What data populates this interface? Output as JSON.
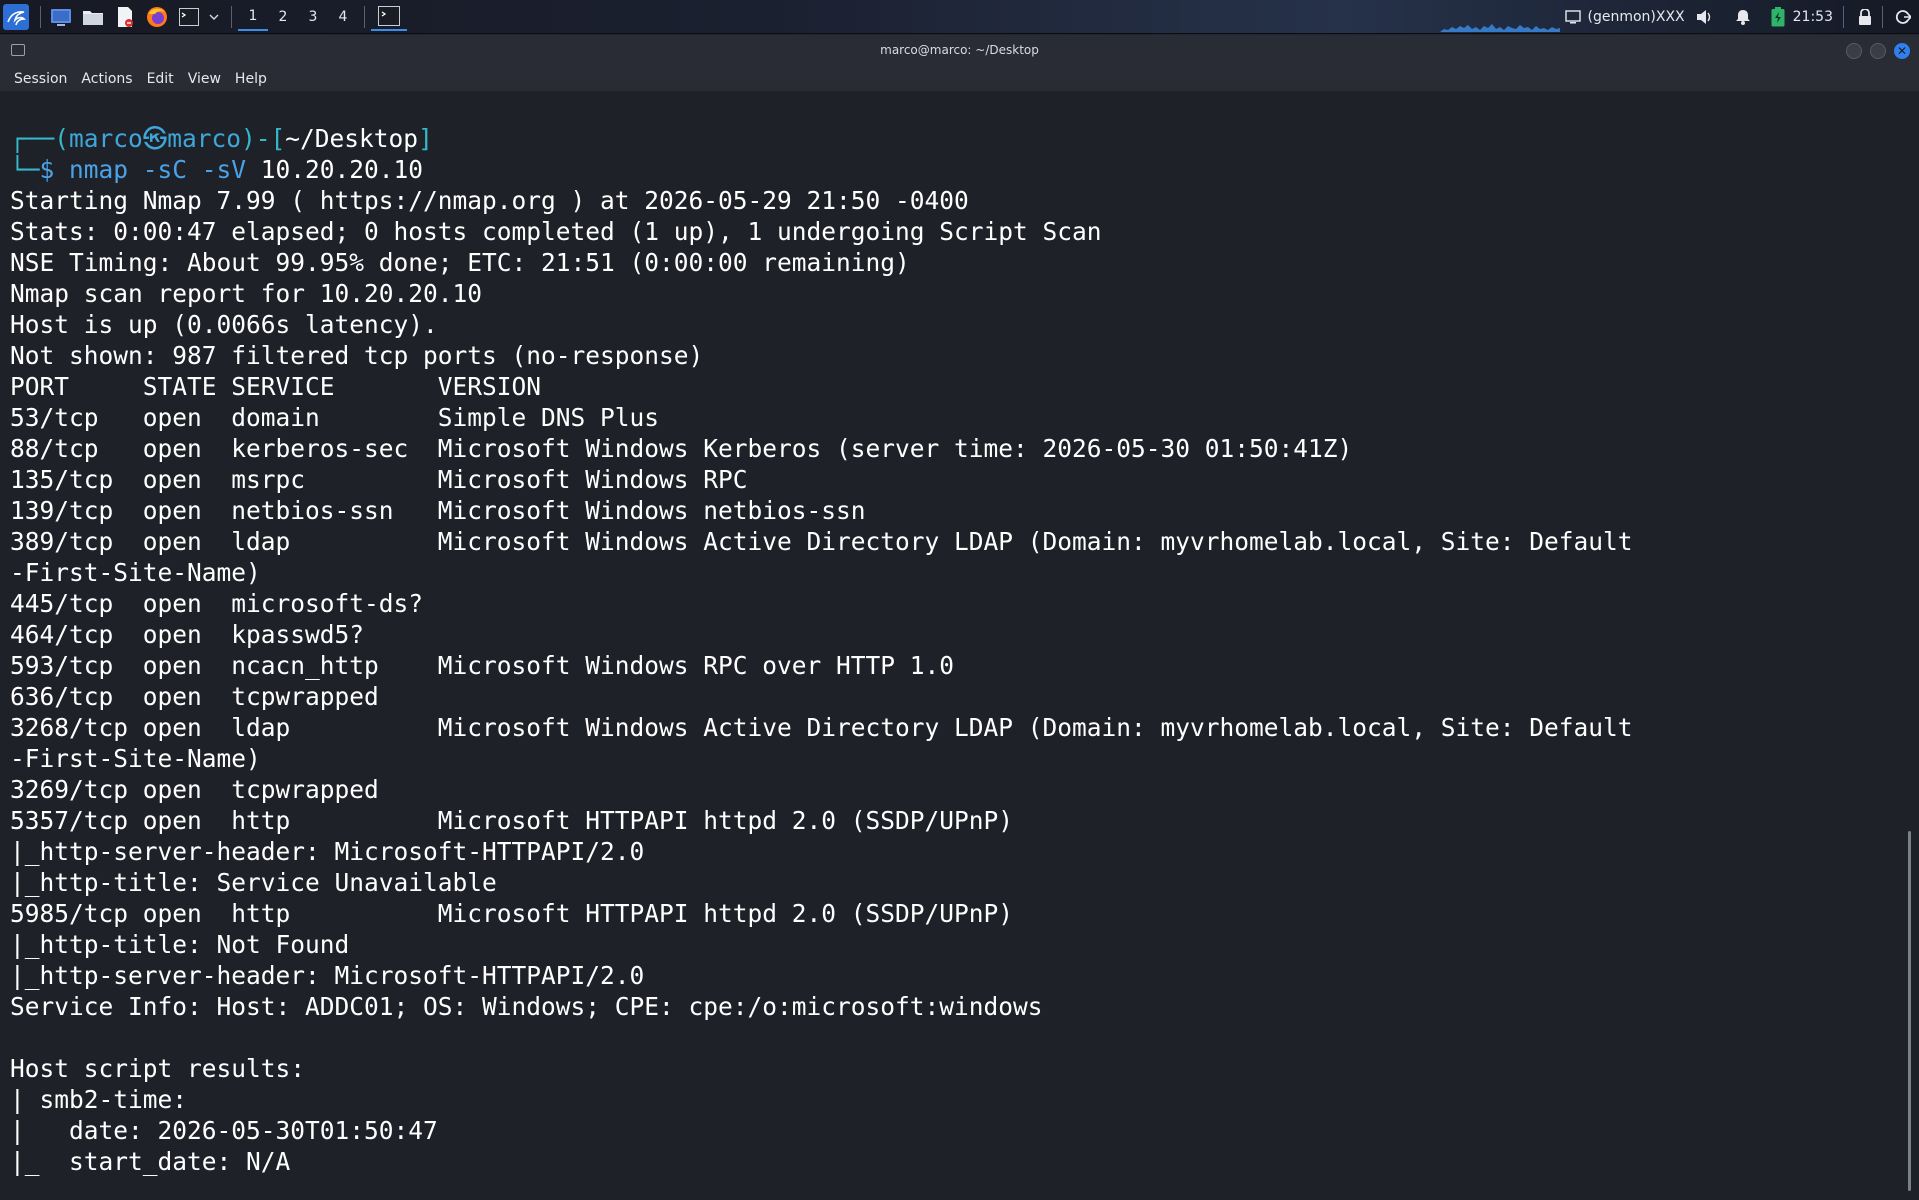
{
  "panel": {
    "workspaces": [
      "1",
      "2",
      "3",
      "4"
    ],
    "active_workspace": "1",
    "genmon": "(genmon)XXX",
    "clock": "21:53",
    "icons": [
      "kali-menu-icon",
      "desktop-icon",
      "file-manager-icon",
      "text-editor-icon",
      "firefox-icon",
      "terminal-icon",
      "dropdown-arrow-icon",
      "display-icon",
      "volume-icon",
      "notifications-icon",
      "battery-icon",
      "lock-icon",
      "logout-icon"
    ]
  },
  "window": {
    "title": "marco@marco: ~/Desktop",
    "menu": [
      "Session",
      "Actions",
      "Edit",
      "View",
      "Help"
    ]
  },
  "colors": {
    "prompt_frame": "#35b8c9",
    "prompt_user": "#3ea7d8",
    "accent": "#2f80ed",
    "terminal_bg": "#1f2129"
  },
  "terminal": {
    "prompt": {
      "frame_top": "┌──(",
      "user": "marco㉿marco",
      "frame_mid": ")-[",
      "path": "~/Desktop",
      "frame_end": "]",
      "frame_bottom": "└─",
      "dollar": "$ ",
      "command": "nmap -sC -sV",
      "target": " 10.20.20.10"
    },
    "lines": [
      "Starting Nmap 7.99 ( https://nmap.org ) at 2026-05-29 21:50 -0400",
      "Stats: 0:00:47 elapsed; 0 hosts completed (1 up), 1 undergoing Script Scan",
      "NSE Timing: About 99.95% done; ETC: 21:51 (0:00:00 remaining)",
      "Nmap scan report for 10.20.20.10",
      "Host is up (0.0066s latency).",
      "Not shown: 987 filtered tcp ports (no-response)",
      "PORT     STATE SERVICE       VERSION",
      "53/tcp   open  domain        Simple DNS Plus",
      "88/tcp   open  kerberos-sec  Microsoft Windows Kerberos (server time: 2026-05-30 01:50:41Z)",
      "135/tcp  open  msrpc         Microsoft Windows RPC",
      "139/tcp  open  netbios-ssn   Microsoft Windows netbios-ssn",
      "389/tcp  open  ldap          Microsoft Windows Active Directory LDAP (Domain: myvrhomelab.local, Site: Default",
      "-First-Site-Name)",
      "445/tcp  open  microsoft-ds?",
      "464/tcp  open  kpasswd5?",
      "593/tcp  open  ncacn_http    Microsoft Windows RPC over HTTP 1.0",
      "636/tcp  open  tcpwrapped",
      "3268/tcp open  ldap          Microsoft Windows Active Directory LDAP (Domain: myvrhomelab.local, Site: Default",
      "-First-Site-Name)",
      "3269/tcp open  tcpwrapped",
      "5357/tcp open  http          Microsoft HTTPAPI httpd 2.0 (SSDP/UPnP)",
      "|_http-server-header: Microsoft-HTTPAPI/2.0",
      "|_http-title: Service Unavailable",
      "5985/tcp open  http          Microsoft HTTPAPI httpd 2.0 (SSDP/UPnP)",
      "|_http-title: Not Found",
      "|_http-server-header: Microsoft-HTTPAPI/2.0",
      "Service Info: Host: ADDC01; OS: Windows; CPE: cpe:/o:microsoft:windows",
      "",
      "Host script results:",
      "| smb2-time:",
      "|   date: 2026-05-30T01:50:47",
      "|_  start_date: N/A"
    ]
  }
}
